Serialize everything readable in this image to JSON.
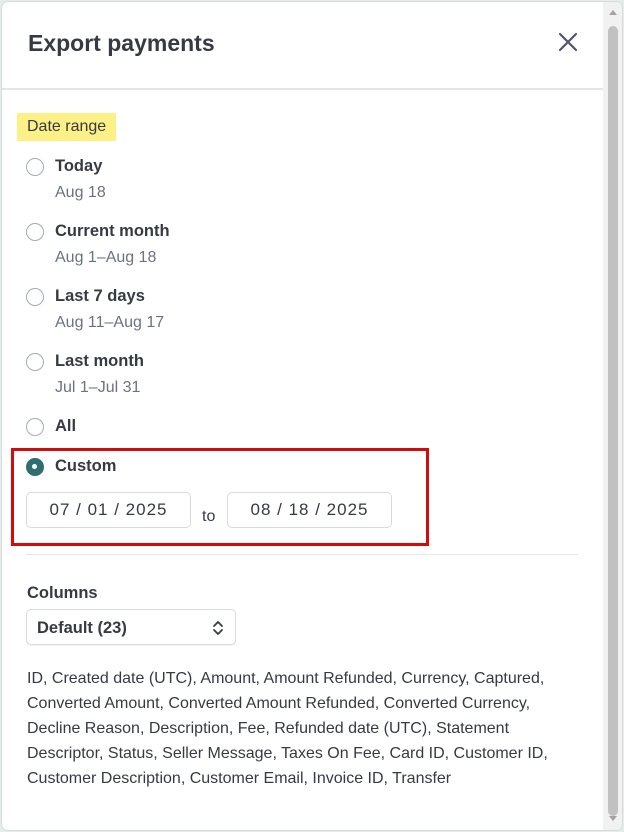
{
  "dialog": {
    "title": "Export payments"
  },
  "date_range": {
    "label": "Date range",
    "options": [
      {
        "label": "Today",
        "sub": "Aug 18",
        "checked": false
      },
      {
        "label": "Current month",
        "sub": "Aug 1–Aug 18",
        "checked": false
      },
      {
        "label": "Last 7 days",
        "sub": "Aug 11–Aug 17",
        "checked": false
      },
      {
        "label": "Last month",
        "sub": "Jul 1–Jul 31",
        "checked": false
      },
      {
        "label": "All",
        "sub": "",
        "checked": false
      },
      {
        "label": "Custom",
        "sub": "",
        "checked": true
      }
    ],
    "custom": {
      "start": "07 / 01 / 2025",
      "to_label": "to",
      "end": "08 / 18 / 2025"
    }
  },
  "columns": {
    "label": "Columns",
    "selected": "Default (23)",
    "description": "ID, Created date (UTC), Amount, Amount Refunded, Currency, Captured, Converted Amount, Converted Amount Refunded, Converted Currency, Decline Reason, Description, Fee, Refunded date (UTC), Statement Descriptor, Status, Seller Message, Taxes On Fee, Card ID, Customer ID, Customer Description, Customer Email, Invoice ID, Transfer"
  },
  "colors": {
    "accent": "#2e6e6e",
    "highlight": "#fdf087",
    "annotation_border": "#d40b0b"
  }
}
